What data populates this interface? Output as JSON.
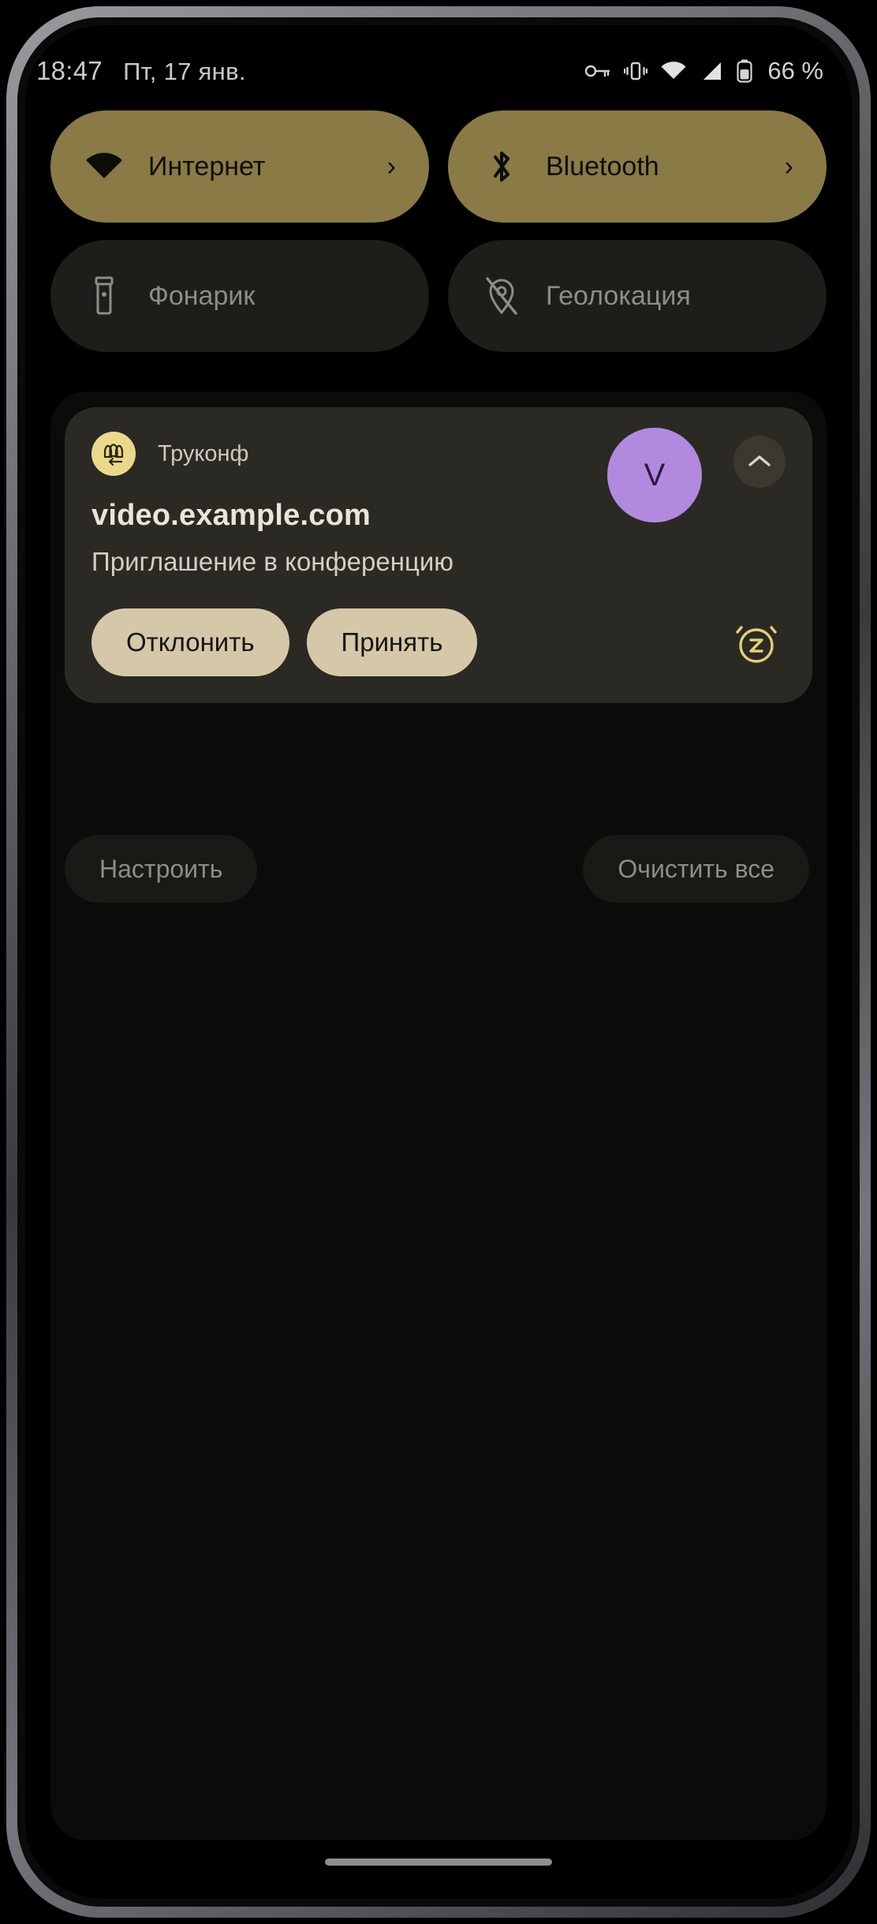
{
  "status_bar": {
    "time": "18:47",
    "date": "Пт, 17 янв.",
    "battery_percent": "66 %",
    "icons": [
      "vpn-key-icon",
      "vibrate-icon",
      "wifi-icon",
      "cellular-signal-icon",
      "battery-icon"
    ]
  },
  "quick_settings": {
    "tiles": [
      {
        "label": "Интернет",
        "icon": "wifi-icon",
        "state": "on",
        "chevron": "›"
      },
      {
        "label": "Bluetooth",
        "icon": "bluetooth-icon",
        "state": "on",
        "chevron": "›"
      },
      {
        "label": "Фонарик",
        "icon": "flashlight-icon",
        "state": "off",
        "chevron": ""
      },
      {
        "label": "Геолокация",
        "icon": "location-off-icon",
        "state": "off",
        "chevron": ""
      }
    ]
  },
  "notification": {
    "app_name": "Труконф",
    "app_icon": "trueconf-group-icon",
    "avatar_initial": "V",
    "collapse_icon": "chevron-up-icon",
    "title": "video.example.com",
    "text": "Приглашение в конференцию",
    "actions": [
      {
        "label": "Отклонить"
      },
      {
        "label": "Принять"
      }
    ],
    "snooze_icon": "alarm-snooze-icon"
  },
  "shade_footer": {
    "manage_label": "Настроить",
    "clear_all_label": "Очистить все"
  },
  "colors": {
    "tile_active": "#8a7a45",
    "tile_inactive": "#1d1d1a",
    "notification_bg": "#2b2923",
    "action_pill": "#d4c8a8",
    "app_icon_bg": "#ead98a",
    "avatar_bg": "#b18ae0",
    "snooze_icon": "#e3cf77",
    "screen_bg": "#000000"
  }
}
